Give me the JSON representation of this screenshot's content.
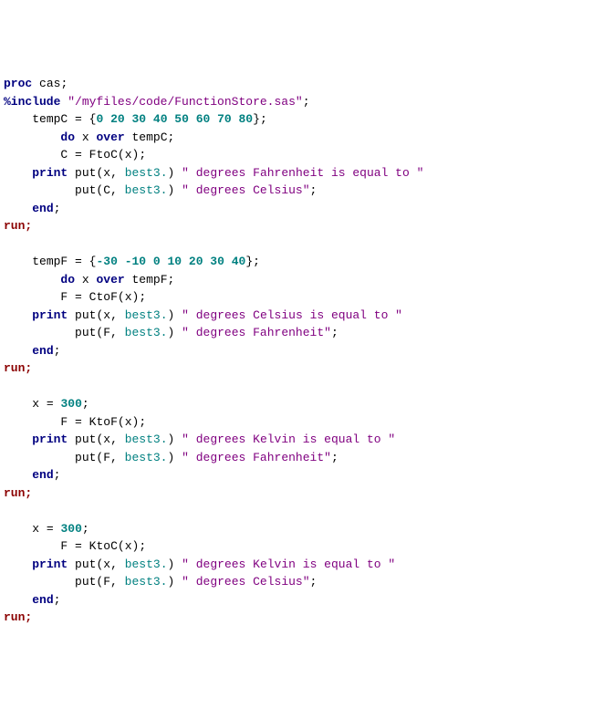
{
  "code": {
    "l1": {
      "prockw": "proc",
      "cas": "cas"
    },
    "l2": {
      "inc": "%include",
      "path": "\"/myfiles/code/FunctionStore.sas\""
    },
    "l3": {
      "var": "tempC",
      "eq": "=",
      "vals": "0 20 30 40 50 60 70 80"
    },
    "l4": {
      "do": "do",
      "x": "x",
      "over": "over",
      "var": "tempC"
    },
    "l5": {
      "c": "C",
      "eq": "=",
      "fn": "FtoC",
      "arg": "x"
    },
    "l6": {
      "print": "print",
      "put": "put",
      "x": "x",
      "fmt": "best3.",
      "s1": "\" degrees Fahrenheit is equal to \""
    },
    "l7": {
      "put": "put",
      "c": "C",
      "fmt": "best3.",
      "s1": "\" degrees Celsius\""
    },
    "l8": {
      "end": "end"
    },
    "l9": {
      "run": "run"
    },
    "l10": {
      "var": "tempF",
      "eq": "=",
      "vals": "-30 -10 0 10 20 30 40"
    },
    "l11": {
      "do": "do",
      "x": "x",
      "over": "over",
      "var": "tempF"
    },
    "l12": {
      "f": "F",
      "eq": "=",
      "fn": "CtoF",
      "arg": "x"
    },
    "l13": {
      "print": "print",
      "put": "put",
      "x": "x",
      "fmt": "best3.",
      "s1": "\" degrees Celsius is equal to \""
    },
    "l14": {
      "put": "put",
      "f": "F",
      "fmt": "best3.",
      "s1": "\" degrees Fahrenheit\""
    },
    "l15": {
      "end": "end"
    },
    "l16": {
      "run": "run"
    },
    "l17": {
      "x": "x",
      "eq": "=",
      "val": "300"
    },
    "l18": {
      "f": "F",
      "eq": "=",
      "fn": "KtoF",
      "arg": "x"
    },
    "l19": {
      "print": "print",
      "put": "put",
      "x": "x",
      "fmt": "best3.",
      "s1": "\" degrees Kelvin is equal to \""
    },
    "l20": {
      "put": "put",
      "f": "F",
      "fmt": "best3.",
      "s1": "\" degrees Fahrenheit\""
    },
    "l21": {
      "end": "end"
    },
    "l22": {
      "run": "run"
    },
    "l23": {
      "x": "x",
      "eq": "=",
      "val": "300"
    },
    "l24": {
      "f": "F",
      "eq": "=",
      "fn": "KtoC",
      "arg": "x"
    },
    "l25": {
      "print": "print",
      "put": "put",
      "x": "x",
      "fmt": "best3.",
      "s1": "\" degrees Kelvin is equal to \""
    },
    "l26": {
      "put": "put",
      "f": "F",
      "fmt": "best3.",
      "s1": "\" degrees Celsius\""
    },
    "l27": {
      "end": "end"
    },
    "l28": {
      "run": "run"
    }
  }
}
